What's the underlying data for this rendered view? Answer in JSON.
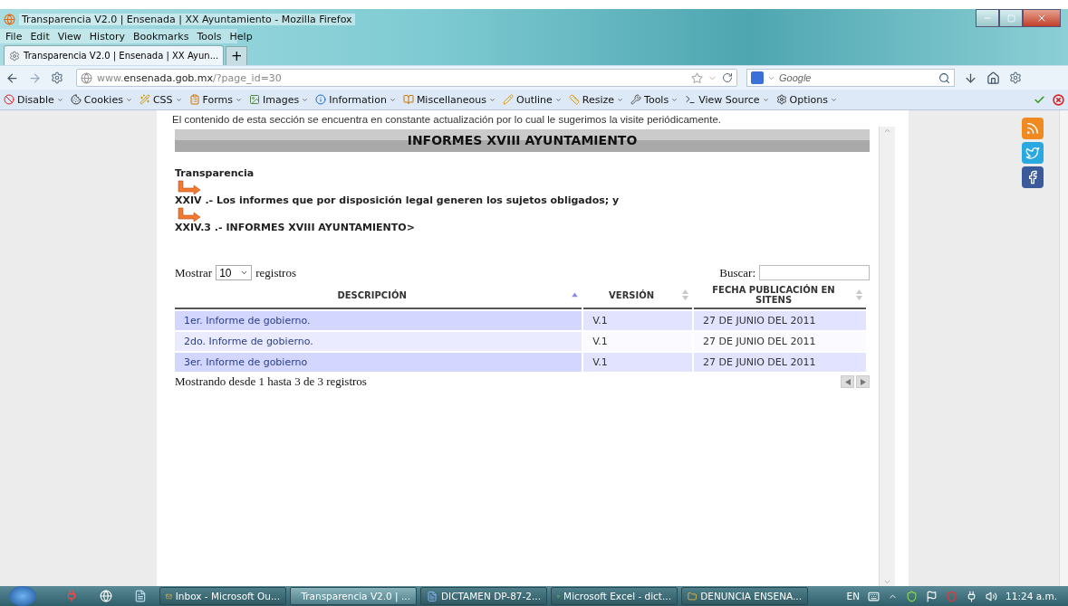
{
  "window": {
    "title": "Transparencia V2.0 | Ensenada | XX Ayuntamiento - Mozilla Firefox"
  },
  "menu": [
    "File",
    "Edit",
    "View",
    "History",
    "Bookmarks",
    "Tools",
    "Help"
  ],
  "tabs": [
    {
      "label": "Transparencia V2.0 | Ensenada | XX Ayun...",
      "selected": true
    }
  ],
  "new_tab": "+",
  "address": {
    "prefix": "www.",
    "domain": "ensenada.gob.mx",
    "path": "/?page_id=30"
  },
  "search": {
    "placeholder": "Google"
  },
  "dev_toolbar": [
    {
      "kind": "disable",
      "label": "Disable"
    },
    {
      "kind": "cookies",
      "label": "Cookies"
    },
    {
      "kind": "css",
      "label": "CSS"
    },
    {
      "kind": "forms",
      "label": "Forms"
    },
    {
      "kind": "images",
      "label": "Images"
    },
    {
      "kind": "information",
      "label": "Information"
    },
    {
      "kind": "misc",
      "label": "Miscellaneous"
    },
    {
      "kind": "outline",
      "label": "Outline"
    },
    {
      "kind": "resize",
      "label": "Resize"
    },
    {
      "kind": "tools",
      "label": "Tools"
    },
    {
      "kind": "source",
      "label": "View Source"
    },
    {
      "kind": "options",
      "label": "Options"
    }
  ],
  "page": {
    "notice": "El contenido de esta sección se encuentra en constante actualización por lo cual le sugerimos la visite periódicamente.",
    "heading": "INFORMES XVIII AYUNTAMIENTO",
    "breadcrumb": [
      "Transparencia",
      "XXIV .- Los informes que por disposición legal generen los sujetos obligados; y",
      "XXIV.3 .- INFORMES XVIII AYUNTAMIENTO>"
    ],
    "length": {
      "before": "Mostrar",
      "value": "10",
      "after": "registros"
    },
    "search_label": "Buscar:",
    "table": {
      "columns": [
        {
          "label": "DESCRIPCIÓN",
          "sorted": true
        },
        {
          "label": "VERSIÓN",
          "sorted": false
        },
        {
          "label": "FECHA PUBLICACIÓN EN SITENS",
          "sorted": false
        }
      ],
      "rows": [
        [
          "1er. Informe de gobierno.",
          "V.1",
          "27 DE JUNIO DEL 2011"
        ],
        [
          "2do. Informe de gobierno.",
          "V.1",
          "27 DE JUNIO DEL 2011"
        ],
        [
          "3er. Informe de gobierno",
          "V.1",
          "27 DE JUNIO DEL 2011"
        ]
      ]
    },
    "info": "Mostrando desde 1 hasta 3 de 3 registros"
  },
  "taskbar": {
    "tasks": [
      {
        "label": "Inbox - Microsoft Ou...",
        "kind": "mail",
        "selected": false
      },
      {
        "label": "Transparencia V2.0 | ...",
        "kind": "firefox",
        "selected": true
      },
      {
        "label": "DICTAMEN DP-87-2...",
        "kind": "word",
        "selected": false
      },
      {
        "label": "Microsoft Excel - dict...",
        "kind": "excel",
        "selected": false
      },
      {
        "label": "DENUNCIA ENSENA...",
        "kind": "folder",
        "selected": false
      }
    ],
    "language": "EN",
    "time": "11:24 a.m."
  }
}
